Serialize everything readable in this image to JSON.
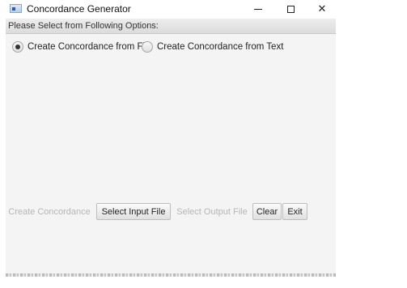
{
  "window": {
    "title": "Concordance Generator",
    "icon": "app-window-icon",
    "controls": {
      "minimize": "minimize-icon",
      "maximize": "maximize-icon",
      "close_label": "✕"
    }
  },
  "header": {
    "text": "Please Select from Following Options:"
  },
  "options": [
    {
      "label": "Create Concordance from File",
      "selected": true
    },
    {
      "label": "Create Concordance from Text",
      "selected": false
    }
  ],
  "buttons": {
    "create": {
      "label": "Create Concordance",
      "enabled": false
    },
    "select_input": {
      "label": "Select Input File",
      "enabled": true
    },
    "select_output": {
      "label": "Select Output File",
      "enabled": false
    },
    "clear": {
      "label": "Clear",
      "enabled": true
    },
    "exit": {
      "label": "Exit",
      "enabled": true
    }
  }
}
